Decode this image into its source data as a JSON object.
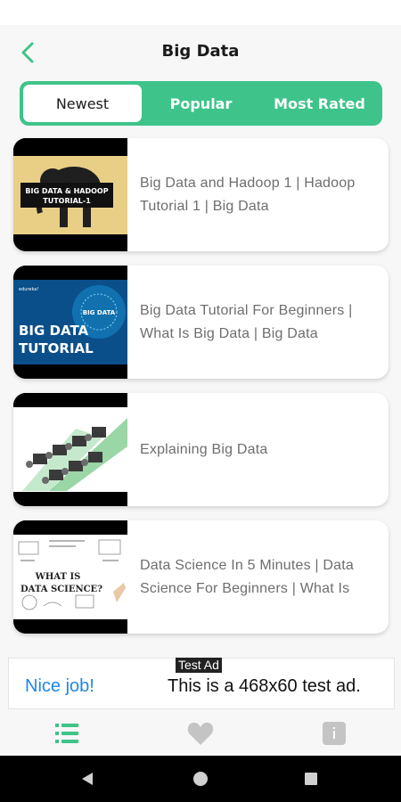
{
  "header": {
    "title": "Big Data"
  },
  "tabs": [
    {
      "label": "Newest"
    },
    {
      "label": "Popular"
    },
    {
      "label": "Most Rated"
    }
  ],
  "videos": [
    {
      "title": "Big Data and Hadoop 1 | Hadoop Tutorial 1 | Big Data",
      "thumb_text": [
        "BIG DATA & HADOOP",
        "TUTORIAL-1"
      ]
    },
    {
      "title": "Big Data Tutorial For Beginners | What Is Big Data | Big Data",
      "thumb_text": [
        "BIG DATA",
        "TUTORIAL",
        "BIG DATA",
        "edureka!"
      ]
    },
    {
      "title": "Explaining Big Data"
    },
    {
      "title": "Data Science In 5 Minutes | Data Science For Beginners | What Is",
      "thumb_text": [
        "WHAT IS",
        "DATA SCIENCE?"
      ]
    }
  ],
  "ad": {
    "tag": "Test Ad",
    "cta": "Nice job!",
    "text": "This is a 468x60 test ad."
  },
  "bottom_nav": [
    {
      "icon": "list-icon"
    },
    {
      "icon": "heart-icon"
    },
    {
      "icon": "info-icon"
    }
  ],
  "colors": {
    "accent": "#3ec48b",
    "ad_link": "#1e88e5"
  }
}
